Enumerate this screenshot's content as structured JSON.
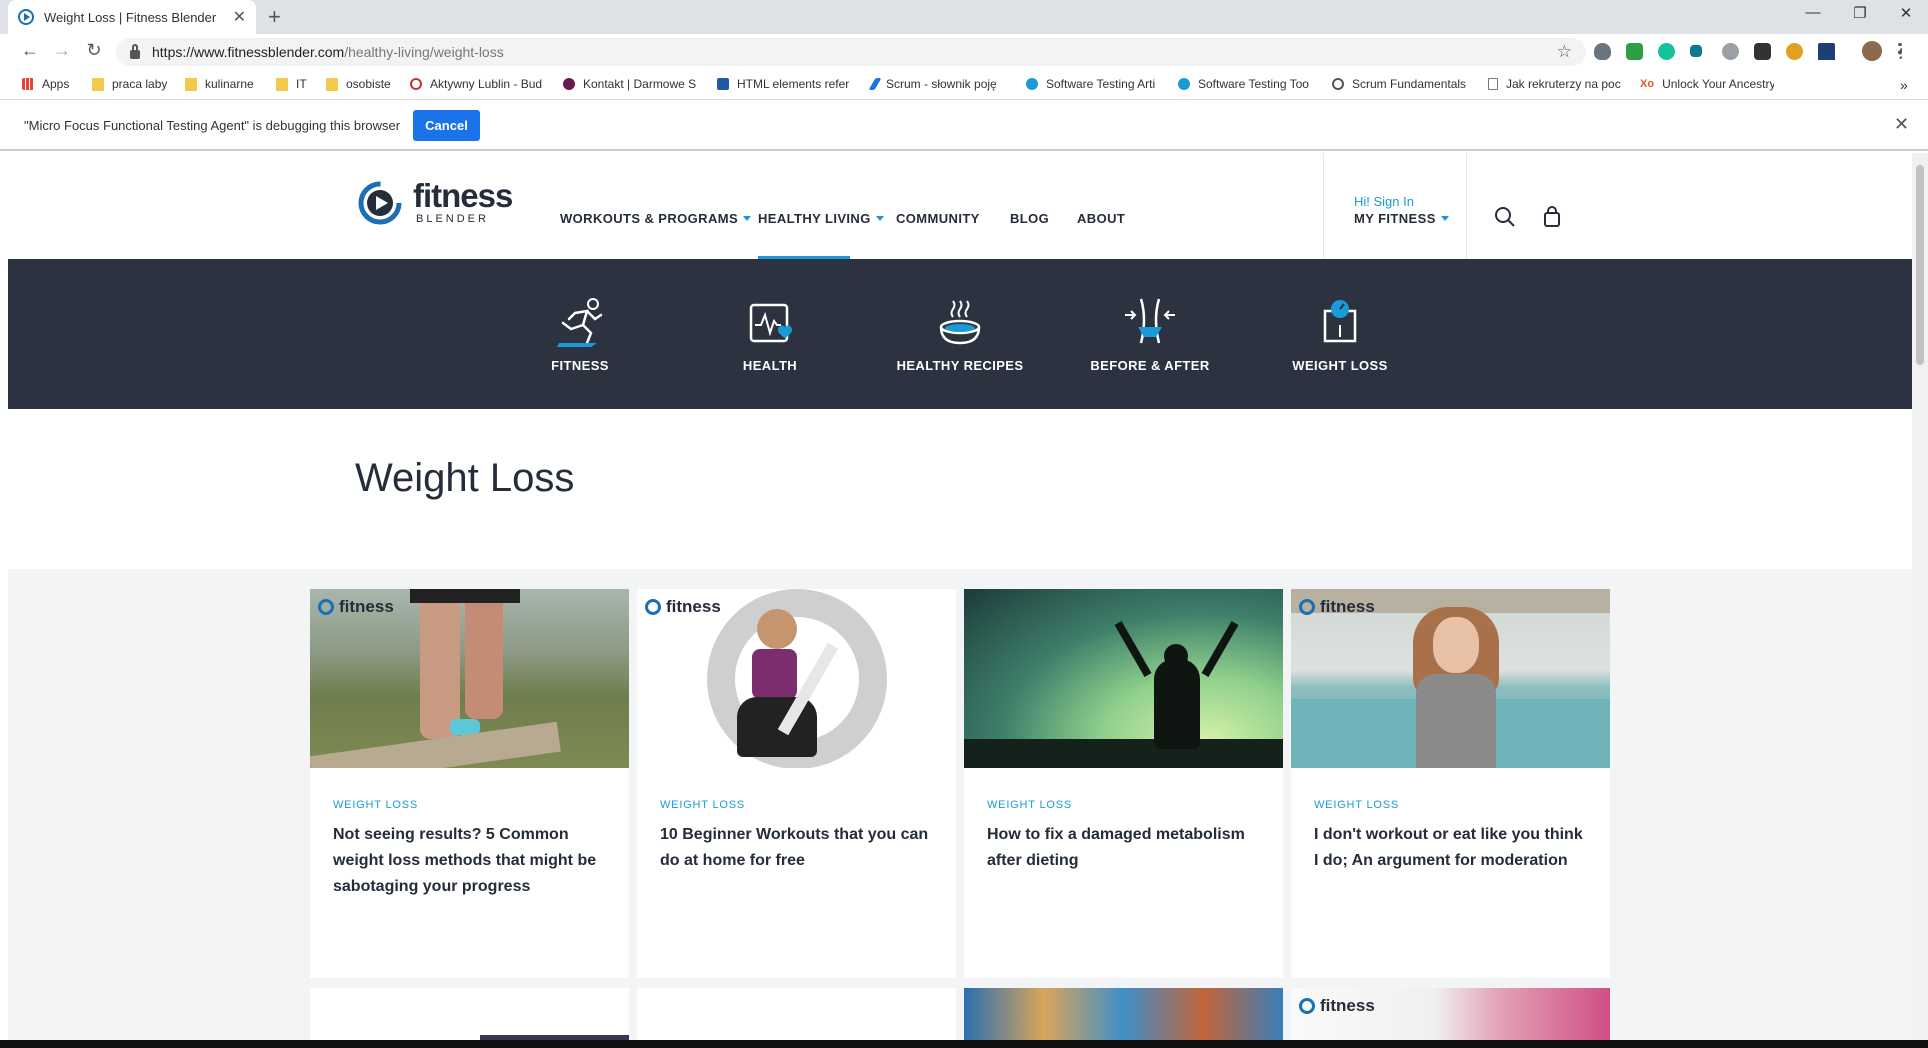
{
  "browser": {
    "tab_title": "Weight Loss | Fitness Blender",
    "tab_close": "✕",
    "new_tab": "+",
    "url_domain": "https://www.fitnessblender.com",
    "url_path": "/healthy-living/weight-loss",
    "window_controls": [
      "—",
      "❐",
      "✕"
    ],
    "bookmarks": [
      "Apps",
      "praca laby",
      "kulinarne",
      "IT",
      "osobiste",
      "Aktywny Lublin - Bud",
      "Kontakt | Darmowe S",
      "HTML elements refer",
      "Scrum - słownik poję",
      "Software Testing Arti",
      "Software Testing Too",
      "Scrum Fundamentals",
      "Jak rekruterzy na poc",
      "Unlock Your Ancestry"
    ],
    "bookmarks_more": "»"
  },
  "debug_bar": {
    "message": "\"Micro Focus Functional Testing Agent\" is debugging this browser",
    "cancel_label": "Cancel",
    "close": "✕"
  },
  "header": {
    "logo_word": "fitness",
    "logo_sub": "BLENDER",
    "nav": [
      "WORKOUTS & PROGRAMS",
      "HEALTHY LIVING",
      "COMMUNITY",
      "BLOG",
      "ABOUT"
    ],
    "active_nav": "HEALTHY LIVING",
    "signin": "Hi! Sign In",
    "my_fitness": "MY FITNESS"
  },
  "categories": [
    "FITNESS",
    "HEALTH",
    "HEALTHY RECIPES",
    "BEFORE & AFTER",
    "WEIGHT LOSS"
  ],
  "page_title": "Weight Loss",
  "watermark": "fitness",
  "cards": [
    {
      "tag": "WEIGHT LOSS",
      "title": "Not seeing results? 5 Common weight loss methods that might be sabotaging your progress"
    },
    {
      "tag": "WEIGHT LOSS",
      "title": "10 Beginner Workouts that you can do at home for free"
    },
    {
      "tag": "WEIGHT LOSS",
      "title": "How to fix a damaged metabolism after dieting"
    },
    {
      "tag": "WEIGHT LOSS",
      "title": "I don't workout or eat like you think I do; An argument for moderation"
    }
  ],
  "colors": {
    "accent": "#1a9bd7",
    "navy": "#252c3a",
    "band": "#2d3240",
    "grid_bg": "#f2f4f6",
    "chrome_blue": "#1a73e8"
  }
}
